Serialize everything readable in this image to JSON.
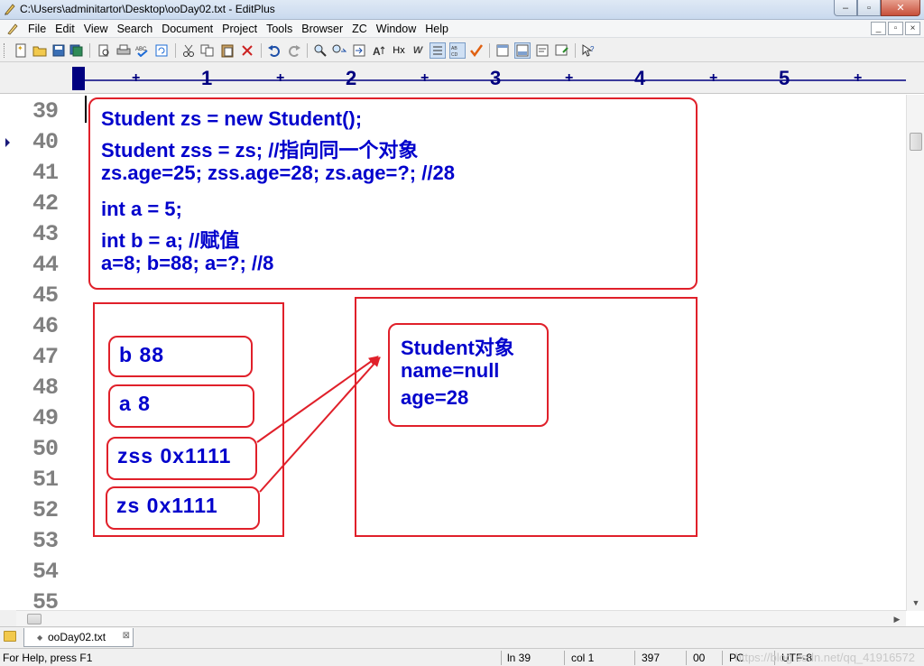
{
  "window": {
    "title": "C:\\Users\\adminitartor\\Desktop\\ooDay02.txt - EditPlus",
    "min": "–",
    "max": "▫",
    "close": "✕"
  },
  "menu": {
    "items": [
      "File",
      "Edit",
      "View",
      "Search",
      "Document",
      "Project",
      "Tools",
      "Browser",
      "ZC",
      "Window",
      "Help"
    ],
    "mdi": [
      "_",
      "▫",
      "×"
    ]
  },
  "ruler": {
    "numbers": [
      "1",
      "2",
      "3",
      "4",
      "5"
    ]
  },
  "gutter": {
    "line_numbers": [
      "39",
      "40",
      "41",
      "42",
      "43",
      "44",
      "45",
      "46",
      "47",
      "48",
      "49",
      "50",
      "51",
      "52",
      "53",
      "54",
      "55"
    ]
  },
  "drawing": {
    "code_lines": [
      "Student zs = new Student();",
      "Student zss = zs; //指向同一个对象",
      "zs.age=25;  zss.age=28;  zs.age=?; //28",
      "int a = 5;",
      "int b = a; //赋值",
      "a=8; b=88;  a=?; //8"
    ],
    "stack_slots": [
      "b  88",
      "a  8",
      "zss  0x1111",
      "zs  0x1111"
    ],
    "object_lines": [
      "Student对象",
      "name=null",
      "age=28"
    ]
  },
  "tabs": [
    {
      "label": "ooDay02.txt"
    }
  ],
  "status": {
    "help": "For Help, press F1",
    "line": "ln 39",
    "col": "col 1",
    "count": "397",
    "code": "00",
    "mode": "PC",
    "encoding": "UTF-8",
    "watermark": "https://blog.csdn.net/qq_41916572"
  },
  "colors": {
    "code_text": "#0000cc",
    "box_border": "#e0202a",
    "ruler_numbers": "#000080"
  }
}
